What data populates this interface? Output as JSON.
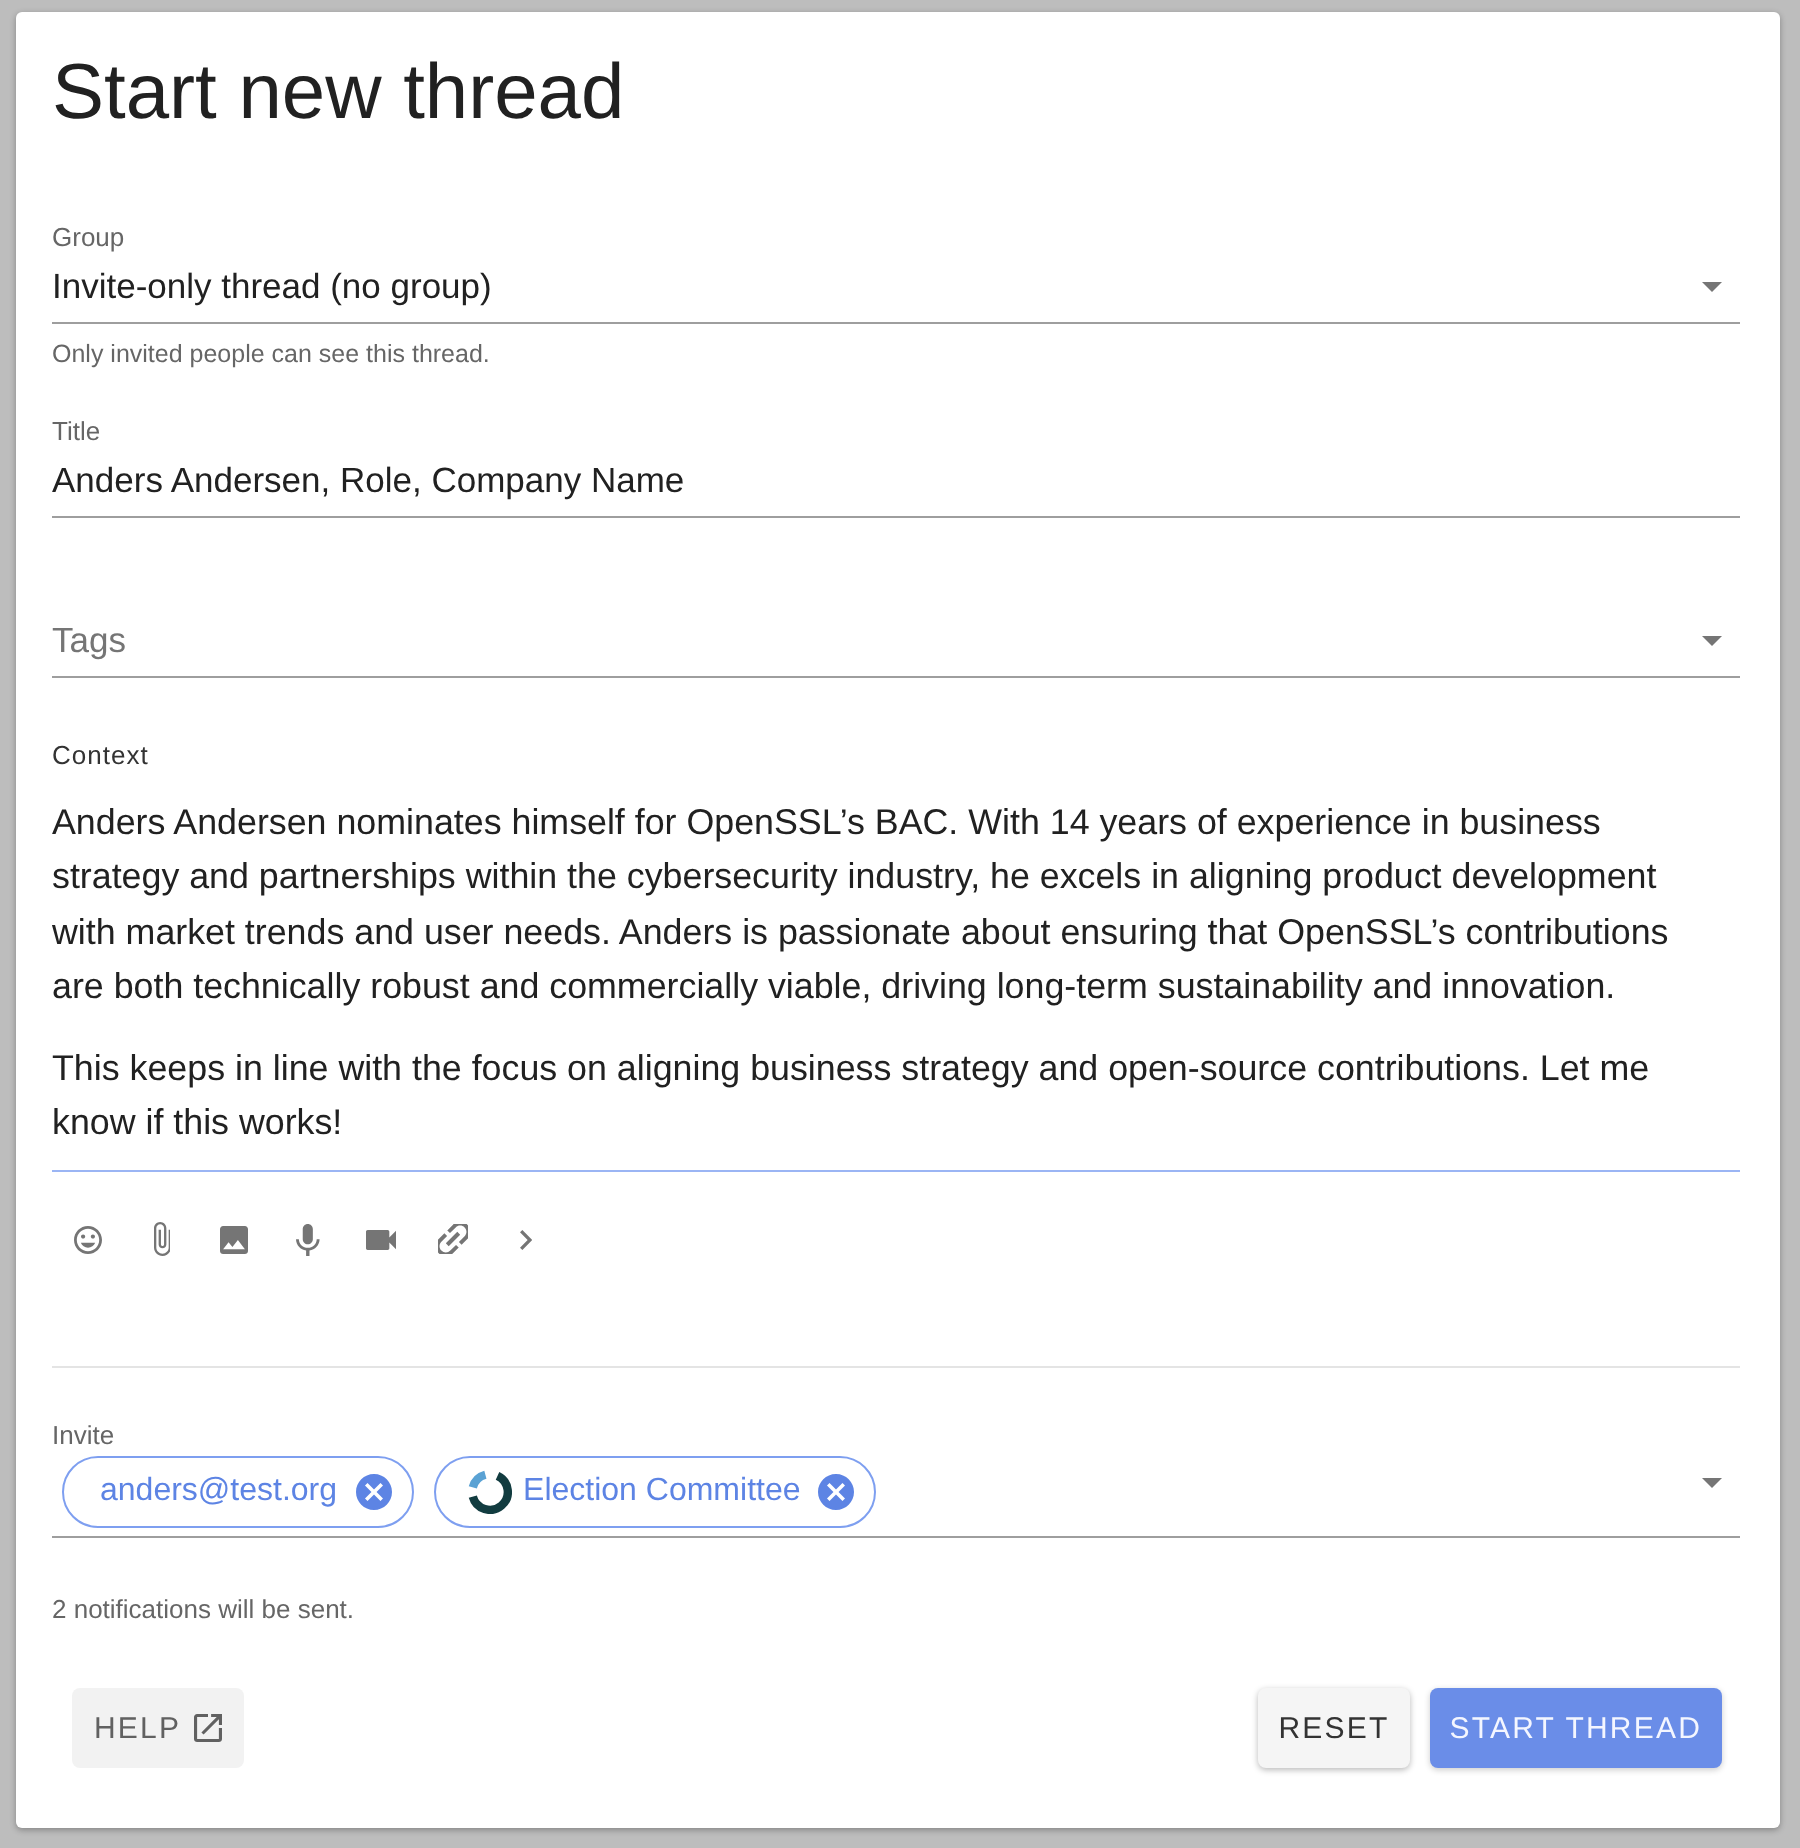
{
  "dialog": {
    "title": "Start new thread"
  },
  "fields": [
    {
      "kind": "select",
      "label": "Group",
      "value": "Invite-only thread (no group)",
      "helper": "Only invited people can see this thread."
    },
    {
      "kind": "text",
      "label": "Title",
      "value": "Anders Andersen, Role, Company Name"
    },
    {
      "kind": "select",
      "placeholder": "Tags"
    }
  ],
  "context": {
    "label": "Context",
    "focused": true,
    "paragraphs": [
      "Anders Andersen nominates himself for OpenSSL’s BAC. With 14 years of experience in business strategy and partnerships within the cybersecurity industry, he excels in aligning product development with market trends and user needs. Anders is passionate about ensuring that OpenSSL’s contributions are both technically robust and commercially viable, driving long-term sustainability and innovation.",
      "This keeps in line with the focus on aligning business strategy and open-source contributions. Let me know if this works!"
    ]
  },
  "invite": {
    "label": "Invite",
    "chips": [
      {
        "kind": "email",
        "label": "anders@test.org"
      },
      {
        "kind": "group",
        "label": "Election Committee"
      }
    ],
    "note": "2 notifications will be sent."
  },
  "buttons": [
    {
      "kind": "help",
      "label": "HELP"
    },
    {
      "kind": "secondary",
      "label": "RESET"
    },
    {
      "kind": "primary",
      "label": "START THREAD"
    }
  ]
}
